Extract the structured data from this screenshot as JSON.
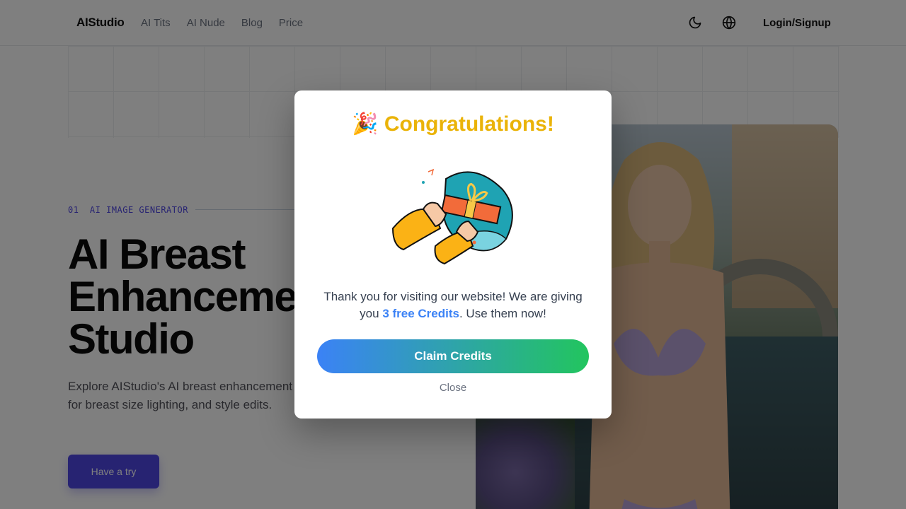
{
  "header": {
    "brand": "AIStudio",
    "nav": [
      "AI Tits",
      "AI Nude",
      "Blog",
      "Price"
    ],
    "theme_icon": "moon-icon",
    "language_icon": "globe-icon",
    "login_label": "Login/Signup"
  },
  "hero": {
    "eyebrow": "01  AI IMAGE GENERATOR",
    "title_lines": [
      "AI Breast",
      "Enhanceme",
      "Studio"
    ],
    "description": "Explore AIStudio's AI breast enhancement choose a focused generator for breast size lighting, and style edits.",
    "cta_label": "Have a try"
  },
  "modal": {
    "emoji": "🎉",
    "heading": "Congratulations!",
    "text_before": "Thank you for visiting our website! We are giving you ",
    "highlight": "3 free Credits",
    "text_after": ". Use them now!",
    "claim_label": "Claim Credits",
    "close_label": "Close",
    "illustration_icon": "gift-box-icon"
  },
  "colors": {
    "accent": "#4f46e5",
    "heading_gold": "#eab308",
    "highlight_blue": "#3b82f6",
    "gradient_start": "#3b82f6",
    "gradient_end": "#22c55e"
  }
}
